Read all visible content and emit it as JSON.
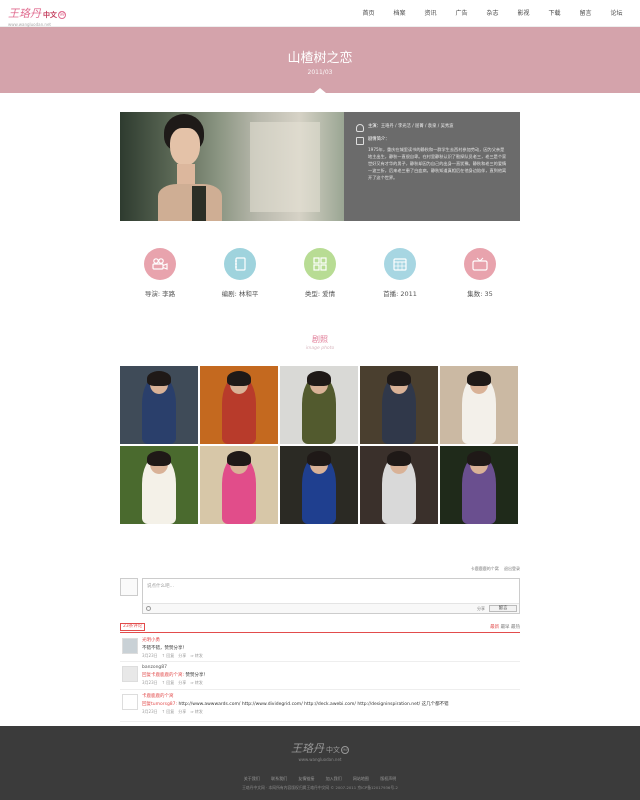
{
  "header": {
    "logo_main": "王珞丹",
    "logo_cn": "中文",
    "logo_ring": "99",
    "logo_url": "www.wangluodan.net",
    "nav": [
      "首页",
      "档案",
      "资讯",
      "广告",
      "杂志",
      "影视",
      "下载",
      "留言",
      "论坛"
    ]
  },
  "hero": {
    "title": "山楂树之恋",
    "date": "2011/03"
  },
  "info": {
    "cast_label": "主演：",
    "cast": "王珞丹 / 李光洁 / 屈菁 / 袁泉 / 吴秀波",
    "synopsis_label": "剧情简介：",
    "synopsis": "1975年，重庆在城里读书的静秋和一群学生去西村参加劳动，因为父亲是地主出生，静秋一直很自卑。在村里静秋认识了勘探队员老三，老三是个家世好又有才华的男子，静秋却因为自己的出身一直犹豫。静秋和老三的爱情一波三折，后来老三患了白血病，静秋知道真相后在他身边陪伴，直到他离开了这个世界。"
  },
  "stats": [
    {
      "label": "导演: 李路",
      "color": "#e8a3ad",
      "icon": "camera-icon"
    },
    {
      "label": "编剧: 林和平",
      "color": "#9fd3dd",
      "icon": "notebook-icon"
    },
    {
      "label": "类型: 爱情",
      "color": "#b8dc94",
      "icon": "grid-icon"
    },
    {
      "label": "首播: 2011",
      "color": "#a7d6e2",
      "icon": "calendar-icon"
    },
    {
      "label": "集数: 35",
      "color": "#e8a3ad",
      "icon": "tv-icon"
    }
  ],
  "stills": {
    "title": "剧照",
    "subtitle": "image photo",
    "tiles": [
      {
        "bg": "#3f4b58",
        "fg": "#2a3f6b"
      },
      {
        "bg": "#c4691f",
        "fg": "#b83b2b"
      },
      {
        "bg": "#d9d9d6",
        "fg": "#525a2e"
      },
      {
        "bg": "#4a3f2f",
        "fg": "#30384a"
      },
      {
        "bg": "#cbb9a3",
        "fg": "#f3f0ea"
      },
      {
        "bg": "#4a6a2e",
        "fg": "#f4f1e8"
      },
      {
        "bg": "#d7c7a8",
        "fg": "#e14d8a"
      },
      {
        "bg": "#2b2a24",
        "fg": "#1f3f8f"
      },
      {
        "bg": "#3a302b",
        "fg": "#d9d9d9"
      },
      {
        "bg": "#1f2a1a",
        "fg": "#6a4f8f"
      }
    ]
  },
  "comments": {
    "top_user": "卡鹿鹿鹿的个窝",
    "top_exit": "退出登录",
    "placeholder": "说点什么吧…",
    "share_label": "分享",
    "submit": "留言",
    "count": "23条评论",
    "sort": [
      "最新",
      "最早",
      "最热"
    ],
    "items": [
      {
        "name": "光明小勇",
        "text": "不错不错，赞赞分享！",
        "hl": "",
        "meta": "3月23日　↑ 回复　分享　⇒ 转发"
      },
      {
        "name": "banzong87",
        "text": "赞赞分享！",
        "hl": "回复卡鹿鹿鹿的个窝: ",
        "meta": "3月23日　↑ 回复　分享　⇒ 转发"
      },
      {
        "name": "卡鹿鹿鹿的个窝",
        "text": "http://www.awwwards.com/ http://www.dividegrid.com/ http://deck.awebi.com/ http://designinspiration.net/ 这几个都不错",
        "hl": "回复tumorsg87: ",
        "meta": "3月23日　↑ 回复　分享　⇒ 转发"
      }
    ]
  },
  "footer": {
    "logo": "王珞丹",
    "logo_cn": "中文",
    "logo_ring": "99",
    "url": "www.wangluodan.net",
    "links": [
      "关于我们",
      "联系我们",
      "友情链接",
      "加入我们",
      "网站地图",
      "版权声明"
    ],
    "copy": "王珞丹中文网 · 本网所有内容版权归属王珞丹中文网 © 2007-2011 京ICP备12017936号-2"
  }
}
